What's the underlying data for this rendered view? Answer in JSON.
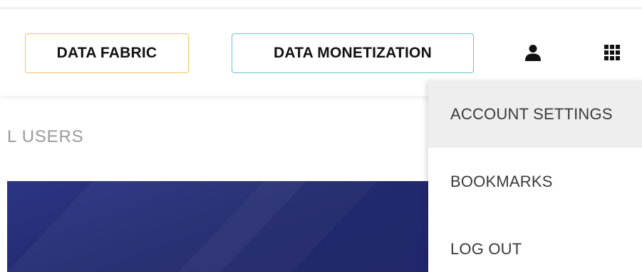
{
  "header": {
    "nav_buttons": [
      {
        "label": "DATA FABRIC",
        "border_color": "#f2c45a"
      },
      {
        "label": "DATA MONETIZATION",
        "border_color": "#64c3cf"
      }
    ],
    "icons": {
      "user": "user-icon",
      "apps": "apps-grid-icon"
    }
  },
  "main": {
    "section_label": "L USERS",
    "banner_color": "#23296f"
  },
  "account_menu": {
    "items": [
      {
        "label": "ACCOUNT SETTINGS",
        "highlighted": true
      },
      {
        "label": "BOOKMARKS",
        "highlighted": false
      },
      {
        "label": "LOG OUT",
        "highlighted": false
      }
    ]
  }
}
